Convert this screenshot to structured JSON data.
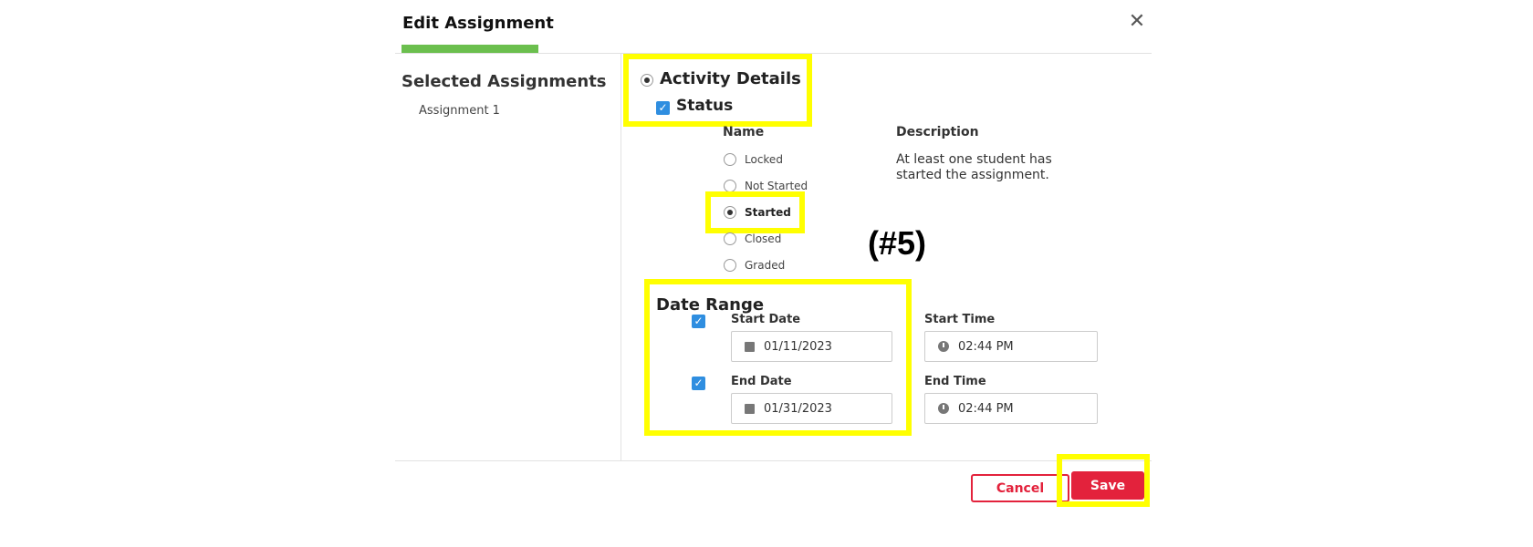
{
  "dialog": {
    "title": "Edit Assignment",
    "close_glyph": "✕"
  },
  "sidebar": {
    "heading": "Selected Assignments",
    "items": [
      {
        "label": "Assignment 1"
      }
    ]
  },
  "activity": {
    "label": "Activity Details",
    "selected": true
  },
  "status": {
    "label": "Status",
    "checked": true,
    "name_header": "Name",
    "description_header": "Description",
    "options": [
      {
        "label": "Locked",
        "selected": false
      },
      {
        "label": "Not Started",
        "selected": false
      },
      {
        "label": "Started",
        "selected": true
      },
      {
        "label": "Closed",
        "selected": false
      },
      {
        "label": "Graded",
        "selected": false
      }
    ],
    "description": "At least one student has started the assignment."
  },
  "callout": "(#5)",
  "date_range": {
    "title": "Date Range",
    "start_date": {
      "label": "Start Date",
      "value": "01/11/2023",
      "checked": true
    },
    "end_date": {
      "label": "End Date",
      "value": "01/31/2023",
      "checked": true
    },
    "start_time": {
      "label": "Start Time",
      "value": "02:44 PM"
    },
    "end_time": {
      "label": "End Time",
      "value": "02:44 PM"
    }
  },
  "footer": {
    "cancel_label": "Cancel",
    "save_label": "Save"
  },
  "colors": {
    "accent_green": "#6bbf4e",
    "highlight_yellow": "#ffff00",
    "danger_red": "#e3223c",
    "checkbox_blue": "#2f8ee0"
  }
}
